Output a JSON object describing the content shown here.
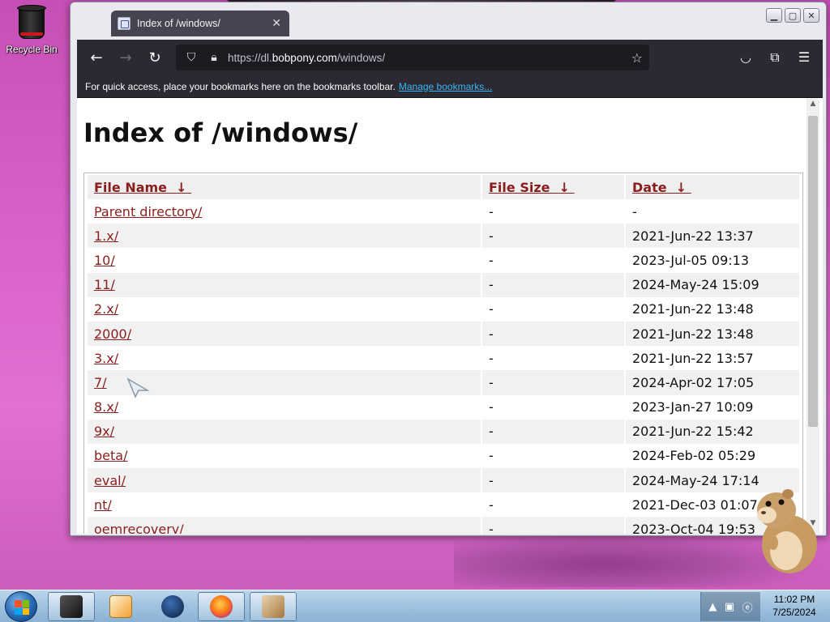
{
  "desktop": {
    "recycle_bin_label": "Recycle Bin"
  },
  "browser": {
    "tab_title": "Index of /windows/",
    "url_prefix": "https://dl.",
    "url_host": "bobpony.com",
    "url_path": "/windows/",
    "bookmarks_message": "For quick access, place your bookmarks here on the bookmarks toolbar.",
    "manage_bookmarks_link": "Manage bookmarks..."
  },
  "page": {
    "title": "Index of /windows/",
    "columns": {
      "name": "File Name",
      "size": "File Size",
      "date": "Date",
      "sort_arrow": "↓"
    },
    "rows": [
      {
        "name": "Parent directory/",
        "size": "-",
        "date": "-"
      },
      {
        "name": "1.x/",
        "size": "-",
        "date": "2021-Jun-22 13:37"
      },
      {
        "name": "10/",
        "size": "-",
        "date": "2023-Jul-05 09:13"
      },
      {
        "name": "11/",
        "size": "-",
        "date": "2024-May-24 15:09"
      },
      {
        "name": "2.x/",
        "size": "-",
        "date": "2021-Jun-22 13:48"
      },
      {
        "name": "2000/",
        "size": "-",
        "date": "2021-Jun-22 13:48"
      },
      {
        "name": "3.x/",
        "size": "-",
        "date": "2021-Jun-22 13:57"
      },
      {
        "name": "7/",
        "size": "-",
        "date": "2024-Apr-02 17:05"
      },
      {
        "name": "8.x/",
        "size": "-",
        "date": "2023-Jan-27 10:09"
      },
      {
        "name": "9x/",
        "size": "-",
        "date": "2021-Jun-22 15:42"
      },
      {
        "name": "beta/",
        "size": "-",
        "date": "2024-Feb-02 05:29"
      },
      {
        "name": "eval/",
        "size": "-",
        "date": "2024-May-24 17:14"
      },
      {
        "name": "nt/",
        "size": "-",
        "date": "2021-Dec-03 01:07"
      },
      {
        "name": "oemrecovery/",
        "size": "-",
        "date": "2023-Oct-04 19:53"
      }
    ]
  },
  "taskbar": {
    "time": "11:02 PM",
    "date": "7/25/2024"
  }
}
